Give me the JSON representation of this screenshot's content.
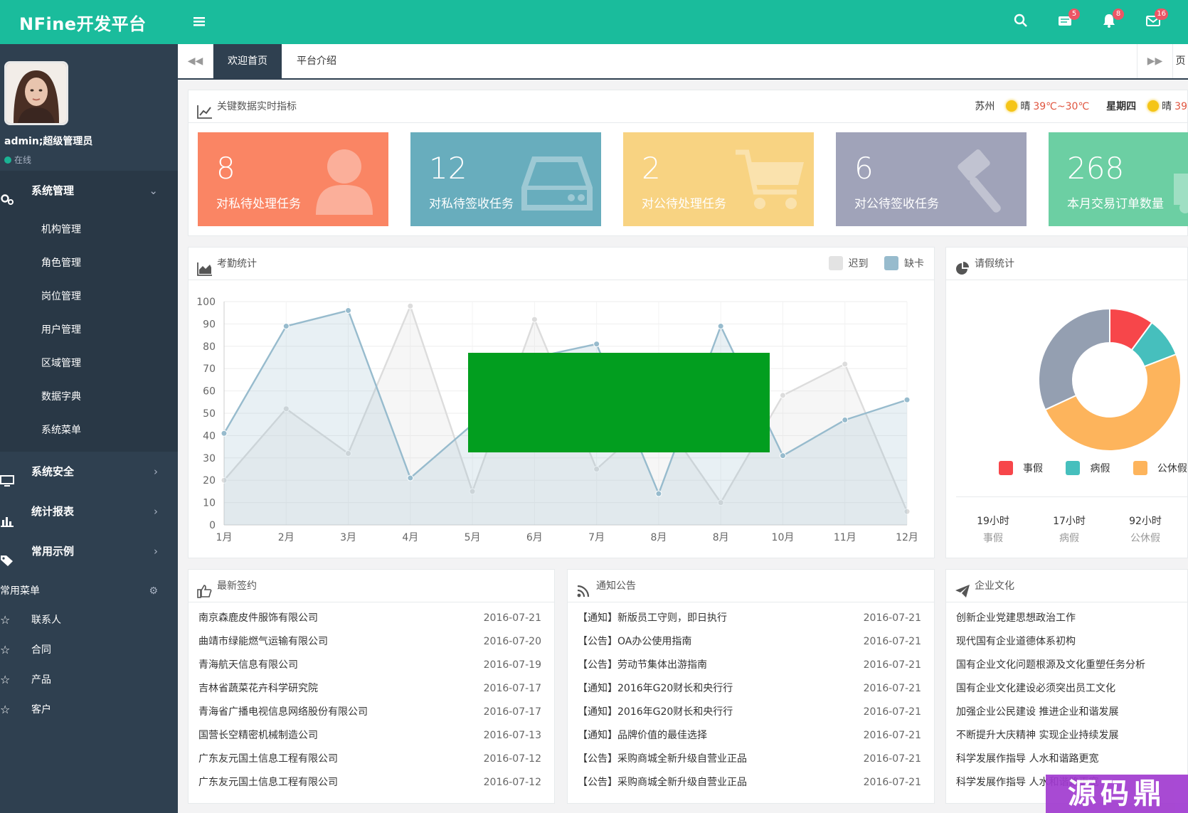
{
  "app": {
    "title": "NFine开发平台"
  },
  "topbar": {
    "badges": {
      "messages": "5",
      "alerts": "8",
      "mail": "16"
    }
  },
  "user": {
    "name": "admin;超级管理员",
    "status": "在线"
  },
  "sidebar": {
    "sections": [
      {
        "label": "系统管理",
        "chevron": "⌄",
        "icon": "gears-icon"
      },
      {
        "label": "系统安全",
        "chevron": "›",
        "icon": "monitor-icon"
      },
      {
        "label": "统计报表",
        "chevron": "›",
        "icon": "bar-chart-icon"
      },
      {
        "label": "常用示例",
        "chevron": "›",
        "icon": "tags-icon"
      }
    ],
    "submenu": [
      "机构管理",
      "角色管理",
      "岗位管理",
      "用户管理",
      "区域管理",
      "数据字典",
      "系统菜单"
    ],
    "common_title": "常用菜单",
    "common_items": [
      "联系人",
      "合同",
      "产品",
      "客户"
    ]
  },
  "tabs": {
    "items": [
      "欢迎首页",
      "平台介绍"
    ],
    "prev": "◀◀",
    "next": "▶▶",
    "overflow": "页"
  },
  "kpi": {
    "title": "关键数据实时指标",
    "weather": {
      "city": "苏州",
      "cond": "晴",
      "temp": "39℃~30℃",
      "day": "星期四",
      "cond2": "晴",
      "temp2": "39"
    },
    "cards": [
      {
        "value": "8",
        "label": "对私待处理任务",
        "color": "#fa8564",
        "icon": "user-icon"
      },
      {
        "value": "12",
        "label": "对私待签收任务",
        "color": "#68adbd",
        "icon": "hdd-icon"
      },
      {
        "value": "2",
        "label": "对公待处理任务",
        "color": "#f8d382",
        "icon": "cart-icon"
      },
      {
        "value": "6",
        "label": "对公待签收任务",
        "color": "#a0a3b9",
        "icon": "gavel-icon"
      },
      {
        "value": "268",
        "label": "本月交易订单数量",
        "color": "#6ccfa3",
        "icon": "truck-icon"
      }
    ]
  },
  "attendance": {
    "title": "考勤统计",
    "legend": [
      "迟到",
      "缺卡"
    ]
  },
  "chart_data": {
    "type": "area",
    "categories": [
      "1月",
      "2月",
      "3月",
      "4月",
      "5月",
      "6月",
      "7月",
      "8月",
      "8月",
      "10月",
      "11月",
      "12月"
    ],
    "ylim": [
      0,
      100
    ],
    "yticks": [
      0,
      10,
      20,
      30,
      40,
      50,
      60,
      70,
      80,
      90,
      100
    ],
    "series": [
      {
        "name": "迟到",
        "color": "#dcdcdc",
        "values": [
          20,
          52,
          32,
          98,
          15,
          92,
          25,
          50,
          10,
          58,
          72,
          6
        ]
      },
      {
        "name": "缺卡",
        "color": "#97bbcd",
        "values": [
          41,
          89,
          96,
          21,
          45,
          75,
          81,
          14,
          89,
          31,
          47,
          56
        ]
      }
    ]
  },
  "leave": {
    "title": "请假统计",
    "legend": [
      {
        "name": "事假",
        "color": "#f7464a"
      },
      {
        "name": "病假",
        "color": "#46bfbd"
      },
      {
        "name": "公休假",
        "color": "#fdb45c"
      }
    ],
    "slices": [
      {
        "name": "事假",
        "value": 19,
        "color": "#f7464a"
      },
      {
        "name": "病假",
        "value": 17,
        "color": "#46bfbd"
      },
      {
        "name": "公休假",
        "value": 92,
        "color": "#fdb45c"
      },
      {
        "name": "other",
        "value": 60,
        "color": "#949fb1"
      }
    ],
    "stats": [
      {
        "value": "19小时",
        "label": "事假"
      },
      {
        "value": "17小时",
        "label": "病假"
      },
      {
        "value": "92小时",
        "label": "公休假"
      }
    ]
  },
  "contracts": {
    "title": "最新签约",
    "items": [
      {
        "name": "南京森鹿皮件服饰有限公司",
        "date": "2016-07-21"
      },
      {
        "name": "曲靖市绿能燃气运输有限公司",
        "date": "2016-07-20"
      },
      {
        "name": "青海航天信息有限公司",
        "date": "2016-07-19"
      },
      {
        "name": "吉林省蔬菜花卉科学研究院",
        "date": "2016-07-17"
      },
      {
        "name": "青海省广播电视信息网络股份有限公司",
        "date": "2016-07-17"
      },
      {
        "name": "国营长空精密机械制造公司",
        "date": "2016-07-13"
      },
      {
        "name": "广东友元国土信息工程有限公司",
        "date": "2016-07-12"
      },
      {
        "name": "广东友元国土信息工程有限公司",
        "date": "2016-07-12"
      }
    ]
  },
  "notices": {
    "title": "通知公告",
    "items": [
      {
        "name": "【通知】新版员工守则，即日执行",
        "date": "2016-07-21"
      },
      {
        "name": "【公告】OA办公使用指南",
        "date": "2016-07-21"
      },
      {
        "name": "【公告】劳动节集体出游指南",
        "date": "2016-07-21"
      },
      {
        "name": "【通知】2016年G20财长和央行行",
        "date": "2016-07-21"
      },
      {
        "name": "【通知】2016年G20财长和央行行",
        "date": "2016-07-21"
      },
      {
        "name": "【通知】品牌价值的最佳选择",
        "date": "2016-07-21"
      },
      {
        "name": "【公告】采购商城全新升级自营业正品",
        "date": "2016-07-21"
      },
      {
        "name": "【公告】采购商城全新升级自营业正品",
        "date": "2016-07-21"
      }
    ]
  },
  "culture": {
    "title": "企业文化",
    "items": [
      "创新企业党建思想政治工作",
      "现代国有企业道德体系初构",
      "国有企业文化问题根源及文化重塑任务分析",
      "国有企业文化建设必须突出员工文化",
      "加强企业公民建设 推进企业和谐发展",
      "不断提升大庆精神 实现企业持续发展",
      "科学发展作指导 人水和谐路更宽",
      "科学发展作指导 人水和谐路更宽"
    ]
  },
  "watermark": {
    "text": "源码鼎"
  }
}
